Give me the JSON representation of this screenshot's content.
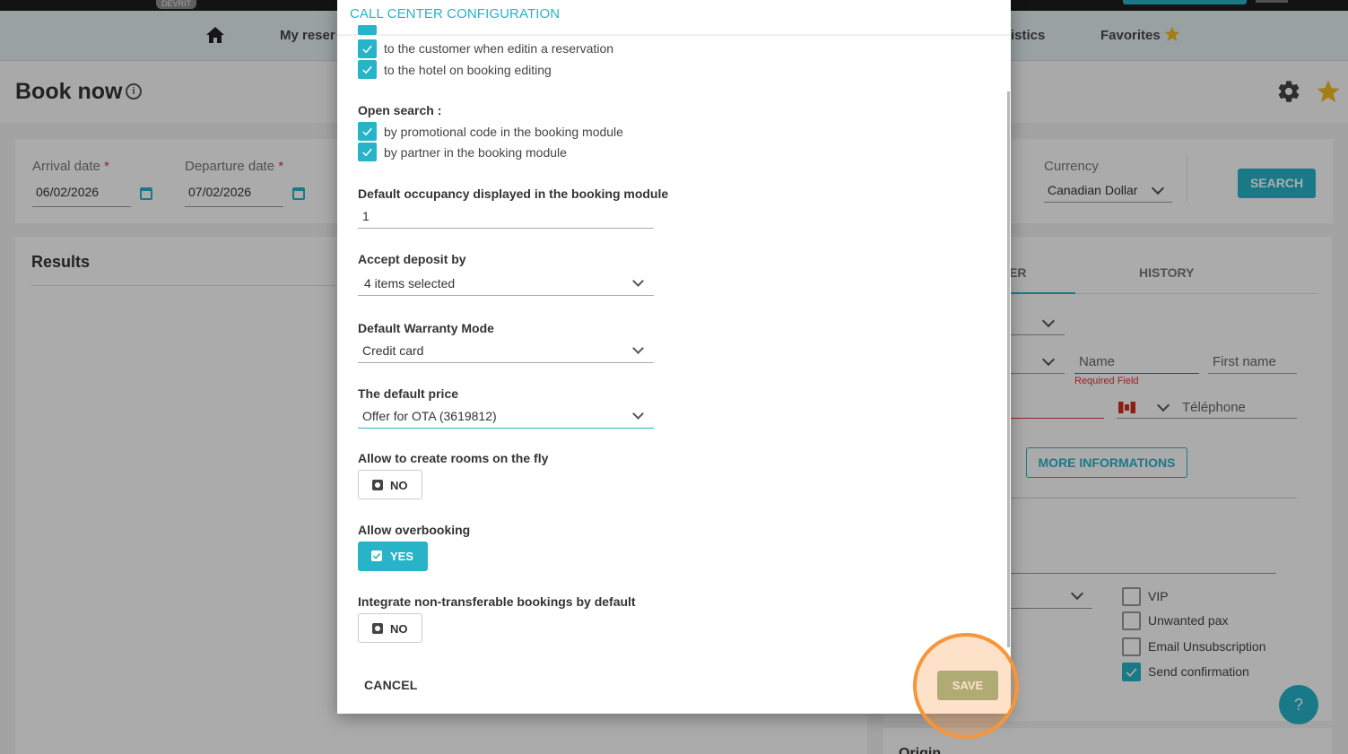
{
  "topbar": {
    "env_badge": "DEVRIT"
  },
  "nav": {
    "items": [
      "My reser",
      "istics",
      "Favorites"
    ]
  },
  "page": {
    "title": "Book now"
  },
  "search": {
    "arrival_label": "Arrival date",
    "arrival_value": "06/02/2026",
    "departure_label": "Departure date",
    "departure_value": "07/02/2026",
    "required_mark": "*",
    "currency_label": "Currency",
    "currency_value": "Canadian Dollar",
    "search_button": "SEARCH"
  },
  "results": {
    "title": "Results"
  },
  "customer_panel": {
    "tab_customer": "ER",
    "tab_history": "HISTORY",
    "name_label": "Name",
    "name_error": "Required Field",
    "first_name_label": "First name",
    "phone_label": "Téléphone",
    "more_button": "MORE INFORMATIONS",
    "checkboxes": [
      {
        "label": "VIP",
        "checked": false
      },
      {
        "label": "Unwanted pax",
        "checked": false
      },
      {
        "label": "Email Unsubscription",
        "checked": false
      },
      {
        "label": "Send confirmation",
        "checked": true
      }
    ],
    "help_button": "?",
    "origin_title": "Origin"
  },
  "modal": {
    "title": "CALL CENTER CONFIGURATION",
    "notify_checkboxes": [
      {
        "label": "to the customer when editin a reservation",
        "checked": true
      },
      {
        "label": "to the hotel on booking editing",
        "checked": true
      }
    ],
    "open_search": {
      "label": "Open search :",
      "options": [
        {
          "label": "by promotional code in the booking module",
          "checked": true
        },
        {
          "label": "by partner in the booking module",
          "checked": true
        }
      ]
    },
    "default_occupancy": {
      "label": "Default occupancy displayed in the booking module",
      "value": "1"
    },
    "accept_deposit": {
      "label": "Accept deposit by",
      "value": "4 items selected"
    },
    "warranty_mode": {
      "label": "Default Warranty Mode",
      "value": "Credit card"
    },
    "default_price": {
      "label": "The default price",
      "value": "Offer for OTA (3619812)"
    },
    "create_rooms": {
      "label": "Allow to create rooms on the fly",
      "value": "NO"
    },
    "overbooking": {
      "label": "Allow overbooking",
      "value": "YES"
    },
    "non_transferable": {
      "label": "Integrate non-transferable bookings by default",
      "value": "NO"
    },
    "cancel_button": "CANCEL",
    "save_button": "SAVE"
  },
  "colors": {
    "accent": "#27b3c8",
    "highlight": "#f7953a",
    "save": "#94b58c",
    "error": "#dd3333"
  },
  "icons": [
    "home-icon",
    "star-icon",
    "info-icon",
    "gear-icon",
    "calendar-icon",
    "chevron-down-icon",
    "checkbox-icon",
    "flag-canada-icon",
    "help-icon"
  ]
}
